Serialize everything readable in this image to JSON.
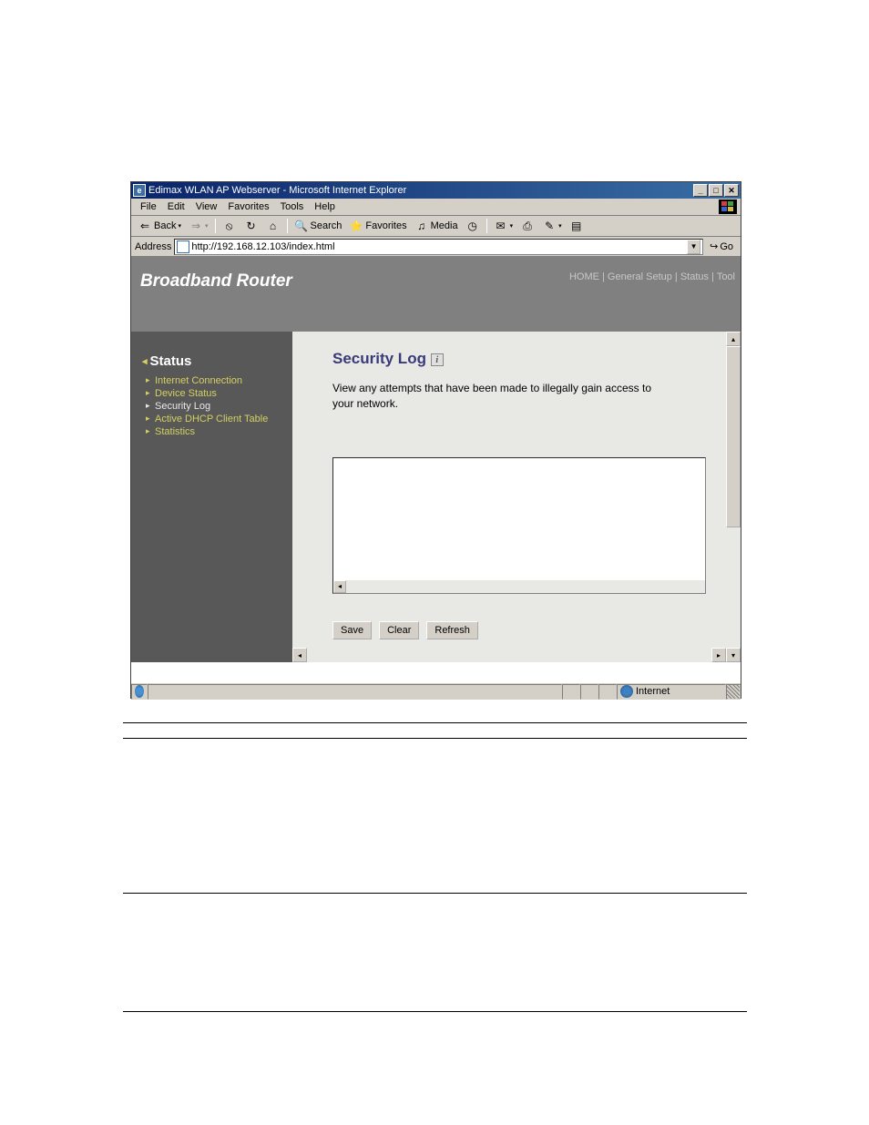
{
  "window": {
    "title": "Edimax WLAN AP Webserver - Microsoft Internet Explorer"
  },
  "menubar": {
    "file": "File",
    "edit": "Edit",
    "view": "View",
    "favorites": "Favorites",
    "tools": "Tools",
    "help": "Help"
  },
  "toolbar": {
    "back": "Back",
    "search": "Search",
    "favorites": "Favorites",
    "media": "Media"
  },
  "addressbar": {
    "label": "Address",
    "url": "http://192.168.12.103/index.html",
    "go": "Go"
  },
  "router": {
    "brand": "Broadband Router",
    "nav": {
      "home": "HOME",
      "general": "General Setup",
      "status": "Status",
      "tool": "Tool"
    }
  },
  "sidebar": {
    "title": "Status",
    "items": [
      "Internet Connection",
      "Device Status",
      "Security Log",
      "Active DHCP Client Table",
      "Statistics"
    ]
  },
  "main": {
    "heading": "Security Log",
    "description": "View any attempts that have been made to illegally gain access to your network.",
    "buttons": {
      "save": "Save",
      "clear": "Clear",
      "refresh": "Refresh"
    }
  },
  "statusbar": {
    "zone": "Internet"
  }
}
